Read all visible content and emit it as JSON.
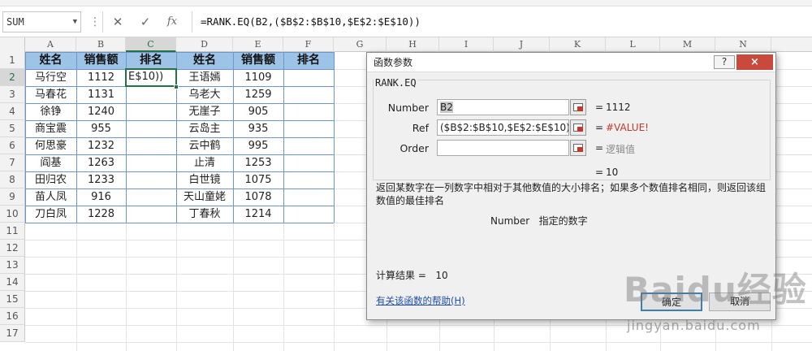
{
  "formula_bar": {
    "name_box": "SUM",
    "cancel_icon": "close-icon",
    "enter_icon": "check-icon",
    "function_icon": "fx-icon",
    "fx_label": "fx",
    "formula": "=RANK.EQ(B2,($B$2:$B$10,$E$2:$E$10))"
  },
  "grid": {
    "columns": [
      "A",
      "B",
      "C",
      "D",
      "E",
      "F",
      "G",
      "H",
      "I",
      "J",
      "K",
      "L",
      "M",
      "N"
    ],
    "rows": [
      "1",
      "2",
      "3",
      "4",
      "5",
      "6",
      "7",
      "8",
      "9",
      "10",
      "11",
      "12",
      "13",
      "14",
      "15",
      "16",
      "17"
    ],
    "selected_column": "C",
    "selected_row": "2",
    "headers": [
      "姓名",
      "销售额",
      "排名",
      "姓名",
      "销售额",
      "排名"
    ],
    "active_cell_text": "E$10))",
    "table_rows": [
      {
        "name1": "马行空",
        "sales1": "1112",
        "name2": "王语嫣",
        "sales2": "1109"
      },
      {
        "name1": "马春花",
        "sales1": "1131",
        "name2": "乌老大",
        "sales2": "1259"
      },
      {
        "name1": "徐铮",
        "sales1": "1240",
        "name2": "无崖子",
        "sales2": "905"
      },
      {
        "name1": "商宝震",
        "sales1": "955",
        "name2": "云岛主",
        "sales2": "935"
      },
      {
        "name1": "何思豪",
        "sales1": "1232",
        "name2": "云中鹤",
        "sales2": "995"
      },
      {
        "name1": "阎基",
        "sales1": "1263",
        "name2": "止清",
        "sales2": "1253"
      },
      {
        "name1": "田归农",
        "sales1": "1233",
        "name2": "白世镜",
        "sales2": "1075"
      },
      {
        "name1": "苗人凤",
        "sales1": "916",
        "name2": "天山童姥",
        "sales2": "1078"
      },
      {
        "name1": "刀白凤",
        "sales1": "1228",
        "name2": "丁春秋",
        "sales2": "1214"
      }
    ]
  },
  "dialog": {
    "title": "函数参数",
    "help_button": "?",
    "close_button": "×",
    "function_name": "RANK.EQ",
    "args": [
      {
        "label": "Number",
        "value": "B2",
        "eq": "=",
        "result": "1112"
      },
      {
        "label": "Ref",
        "value": "($B$2:$B$10,$E$2:$E$10)",
        "eq": "=",
        "result": "#VALUE!"
      },
      {
        "label": "Order",
        "value": "",
        "eq": "=",
        "result": "逻辑值"
      }
    ],
    "overall_eq": "=",
    "overall_result": "10",
    "description": "返回某数字在一列数字中相对于其他数值的大小排名；如果多个数值排名相同，则返回该组数值的最佳排名",
    "param_name": "Number",
    "param_description": "指定的数字",
    "calc_result_label": "计算结果 =",
    "calc_result_value": "10",
    "help_link": "有关该函数的帮助(H)",
    "ok_button": "确定",
    "cancel_button": "取消"
  },
  "watermark": {
    "logo": "Baidu经验",
    "url": "jingyan.baidu.com"
  },
  "colors": {
    "header_fill": "#9dc3e6",
    "table_border": "#6f96c7",
    "excel_green": "#217346",
    "error_red": "#c0392b",
    "close_red": "#c94a3c"
  }
}
